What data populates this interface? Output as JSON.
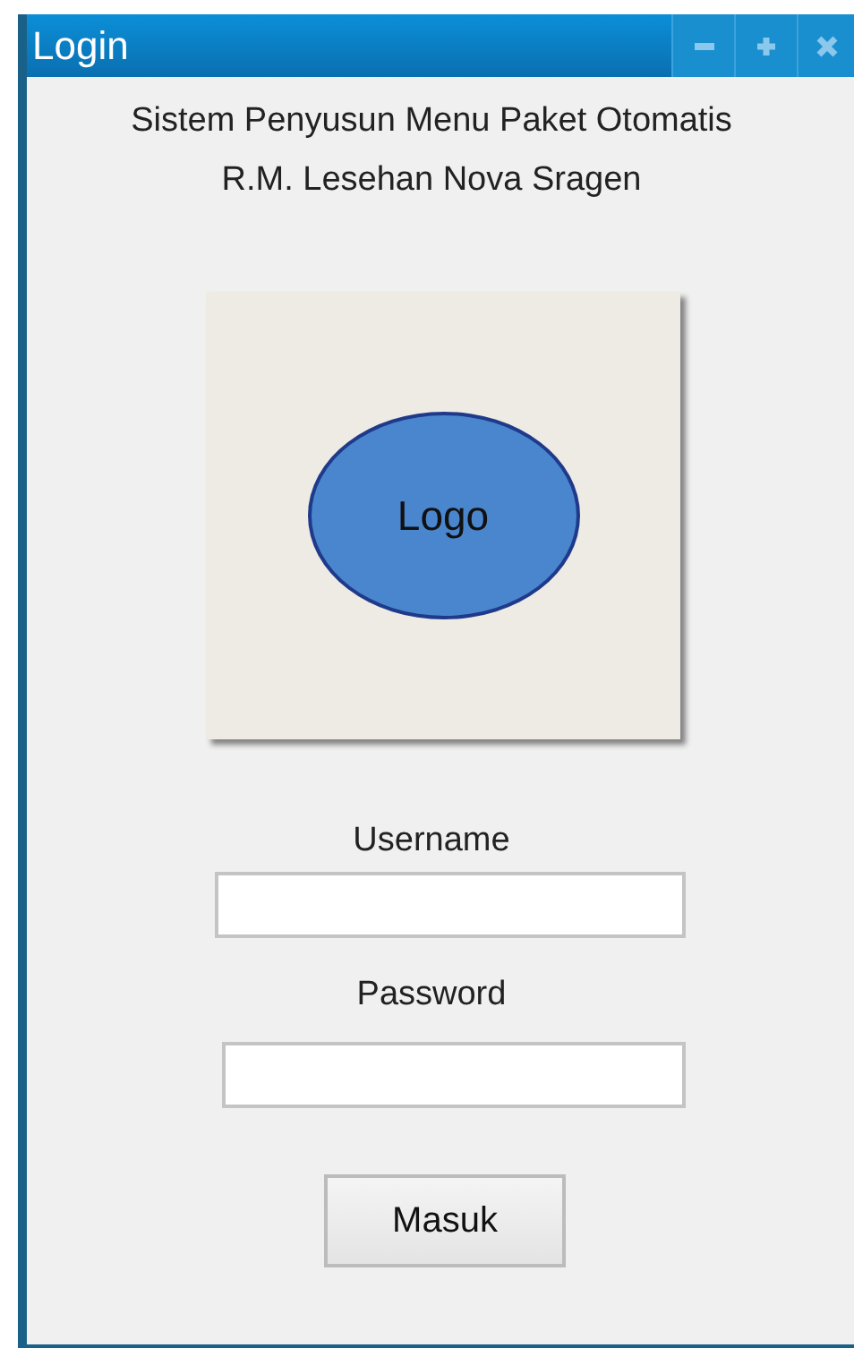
{
  "window": {
    "title": "Login"
  },
  "header": [
    "Sistem Penyusun Menu Paket Otomatis",
    "R.M. Lesehan Nova Sragen"
  ],
  "logo": {
    "label": "Logo"
  },
  "fields": [
    {
      "label": "Username"
    },
    {
      "label": "Password"
    }
  ],
  "button": "Masuk"
}
